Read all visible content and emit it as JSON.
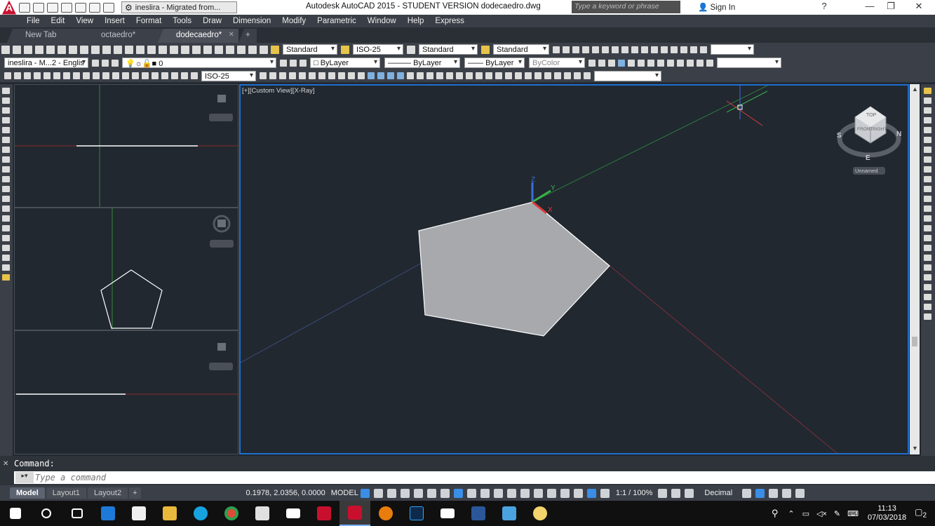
{
  "titlebar": {
    "workspace": "ineslira - Migrated from...",
    "title": "Autodesk AutoCAD 2015 - STUDENT VERSION    dodecaedro.dwg",
    "search_placeholder": "Type a keyword or phrase",
    "signin": "Sign In"
  },
  "menu": [
    "File",
    "Edit",
    "View",
    "Insert",
    "Format",
    "Tools",
    "Draw",
    "Dimension",
    "Modify",
    "Parametric",
    "Window",
    "Help",
    "Express"
  ],
  "file_tabs": [
    {
      "label": "New Tab",
      "active": false
    },
    {
      "label": "octaedro*",
      "active": false
    },
    {
      "label": "dodecaedro*",
      "active": true
    }
  ],
  "toolbar1": {
    "text_style": "Standard",
    "dim_style": "ISO-25",
    "table_style": "Standard",
    "mleader_style": "Standard"
  },
  "toolbar2": {
    "workspace": "ineslira - M...2 - Englis",
    "layer": "0",
    "color": "ByLayer",
    "linetype": "ByLayer",
    "lineweight": "ByLayer",
    "plotstyle": "ByColor"
  },
  "toolbar3": {
    "dim_style": "ISO-25"
  },
  "viewport": {
    "label": "[+][Custom View][X-Ray]"
  },
  "viewcube": {
    "top": "TOP",
    "front": "FRONT",
    "right": "RIGHT",
    "n": "N",
    "s": "S",
    "e": "E",
    "ucs": "Unnamed"
  },
  "command": {
    "history": "Command:",
    "placeholder": "Type a command"
  },
  "layout_tabs": [
    {
      "label": "Model",
      "active": true
    },
    {
      "label": "Layout1",
      "active": false
    },
    {
      "label": "Layout2",
      "active": false
    }
  ],
  "status": {
    "coords": "0.1978, 2.0356, 0.0000",
    "space": "MODEL",
    "scale": "1:1 / 100%",
    "units": "Decimal"
  },
  "clock": {
    "time": "11:13",
    "date": "07/03/2018"
  },
  "notification_count": "2",
  "colors": {
    "accent": "#1f6fd0",
    "canvas": "#212830",
    "face": "#a7a9ad"
  }
}
